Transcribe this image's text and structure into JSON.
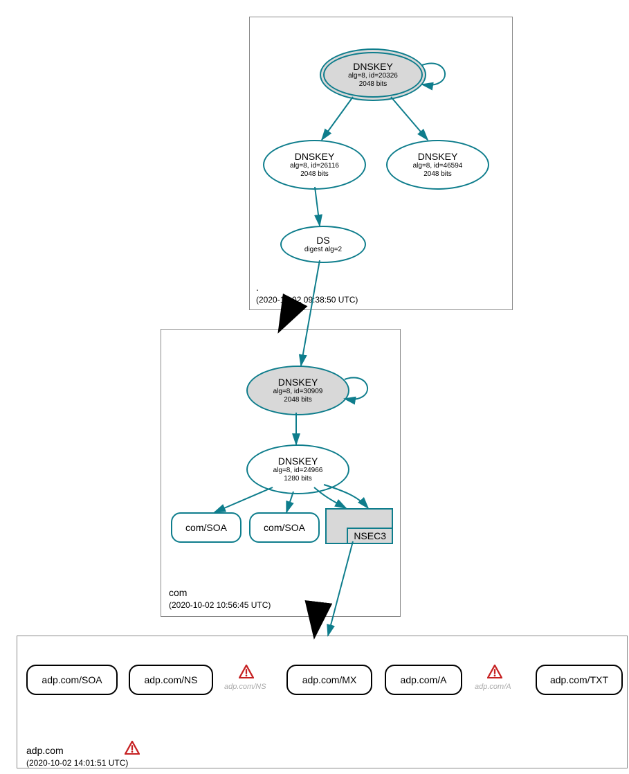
{
  "zones": {
    "root": {
      "name": ".",
      "timestamp": "(2020-10-02 09:38:50 UTC)",
      "keys": {
        "ksk": {
          "title": "DNSKEY",
          "alg": "alg=8, id=20326",
          "bits": "2048 bits"
        },
        "zsk1": {
          "title": "DNSKEY",
          "alg": "alg=8, id=26116",
          "bits": "2048 bits"
        },
        "zsk2": {
          "title": "DNSKEY",
          "alg": "alg=8, id=46594",
          "bits": "2048 bits"
        }
      },
      "ds": {
        "title": "DS",
        "sub": "digest alg=2"
      }
    },
    "com": {
      "name": "com",
      "timestamp": "(2020-10-02 10:56:45 UTC)",
      "keys": {
        "ksk": {
          "title": "DNSKEY",
          "alg": "alg=8, id=30909",
          "bits": "2048 bits"
        },
        "zsk": {
          "title": "DNSKEY",
          "alg": "alg=8, id=24966",
          "bits": "1280 bits"
        }
      },
      "records": {
        "soa1": "com/SOA",
        "soa2": "com/SOA",
        "nsec3": "NSEC3"
      }
    },
    "adp": {
      "name": "adp.com",
      "timestamp": "(2020-10-02 14:01:51 UTC)",
      "records": {
        "soa": "adp.com/SOA",
        "ns": "adp.com/NS",
        "ns_warn": "adp.com/NS",
        "mx": "adp.com/MX",
        "a": "adp.com/A",
        "a_warn": "adp.com/A",
        "txt": "adp.com/TXT"
      }
    }
  }
}
